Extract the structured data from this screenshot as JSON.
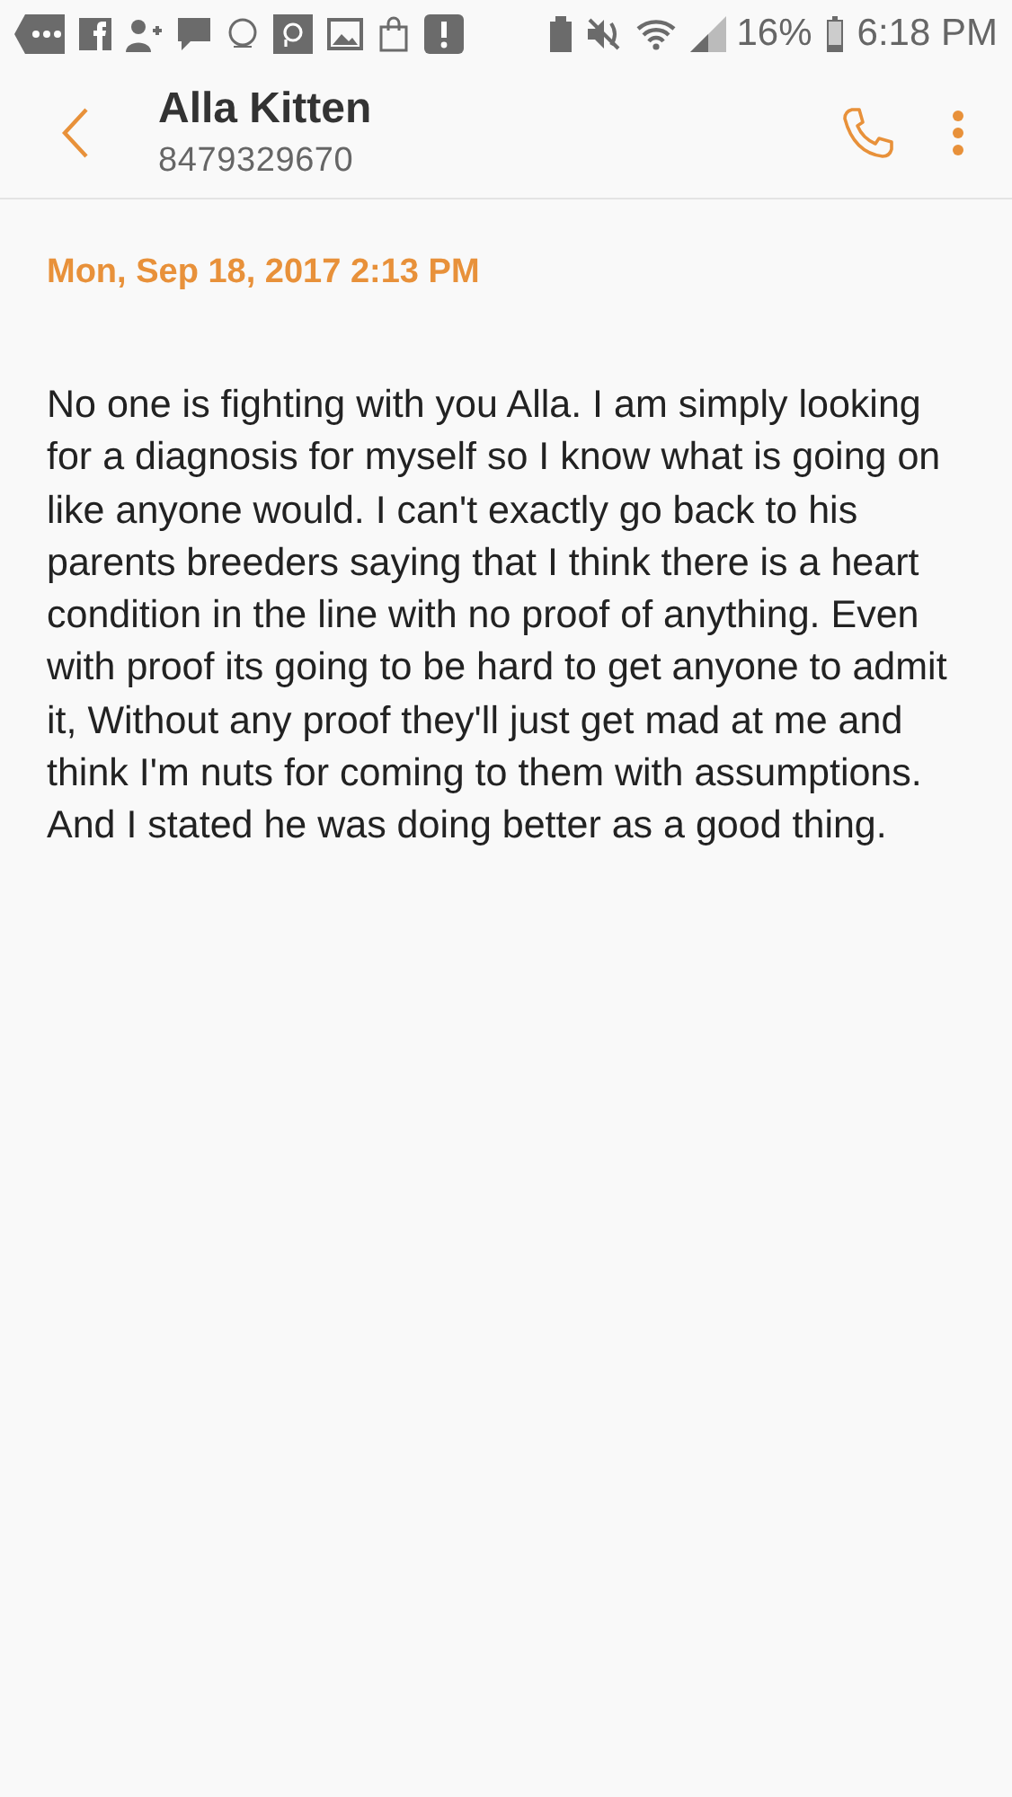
{
  "status_bar": {
    "battery": "16%",
    "time": "6:18 PM"
  },
  "header": {
    "name": "Alla Kitten",
    "number": "8479329670"
  },
  "message": {
    "date": "Mon, Sep 18, 2017 2:13 PM",
    "body": "No one is fighting with you Alla. I am simply looking for a diagnosis for myself so I know what is going on like anyone would. I can't exactly go back to his parents breeders saying that I think there is a heart condition in the line with no proof of anything. Even with proof its going to be hard to get anyone to admit it,  Without any proof they'll just get mad at me and think I'm nuts for coming to them with assumptions.\nAnd I stated he was doing better as a good thing."
  }
}
